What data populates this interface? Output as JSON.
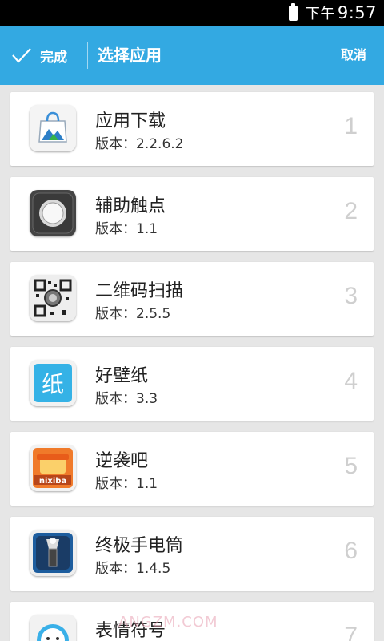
{
  "status_bar": {
    "time_prefix": "下午",
    "time": "9:57"
  },
  "action_bar": {
    "done_label": "完成",
    "title": "选择应用",
    "cancel_label": "取消"
  },
  "apps": [
    {
      "name": "应用下载",
      "version": "版本：2.2.6.2",
      "index": "1",
      "icon": "app-store-bag-icon"
    },
    {
      "name": "辅助触点",
      "version": "版本：1.1",
      "index": "2",
      "icon": "assistive-touch-icon"
    },
    {
      "name": "二维码扫描",
      "version": "版本：2.5.5",
      "index": "3",
      "icon": "qr-scanner-icon"
    },
    {
      "name": "好壁纸",
      "version": "版本：3.3",
      "index": "4",
      "icon": "wallpaper-icon"
    },
    {
      "name": "逆袭吧",
      "version": "版本：1.1",
      "index": "5",
      "icon": "nixiba-icon"
    },
    {
      "name": "终极手电筒",
      "version": "版本：1.4.5",
      "index": "6",
      "icon": "flashlight-icon"
    },
    {
      "name": "表情符号",
      "version": "",
      "index": "7",
      "icon": "emoji-icon"
    }
  ],
  "icon_texts": {
    "nixiba": "nixiba",
    "wallpaper": "纸"
  },
  "watermark": "ANGZM.COM",
  "colors": {
    "action_bar": "#33a9e2",
    "background": "#e6e6e6"
  }
}
